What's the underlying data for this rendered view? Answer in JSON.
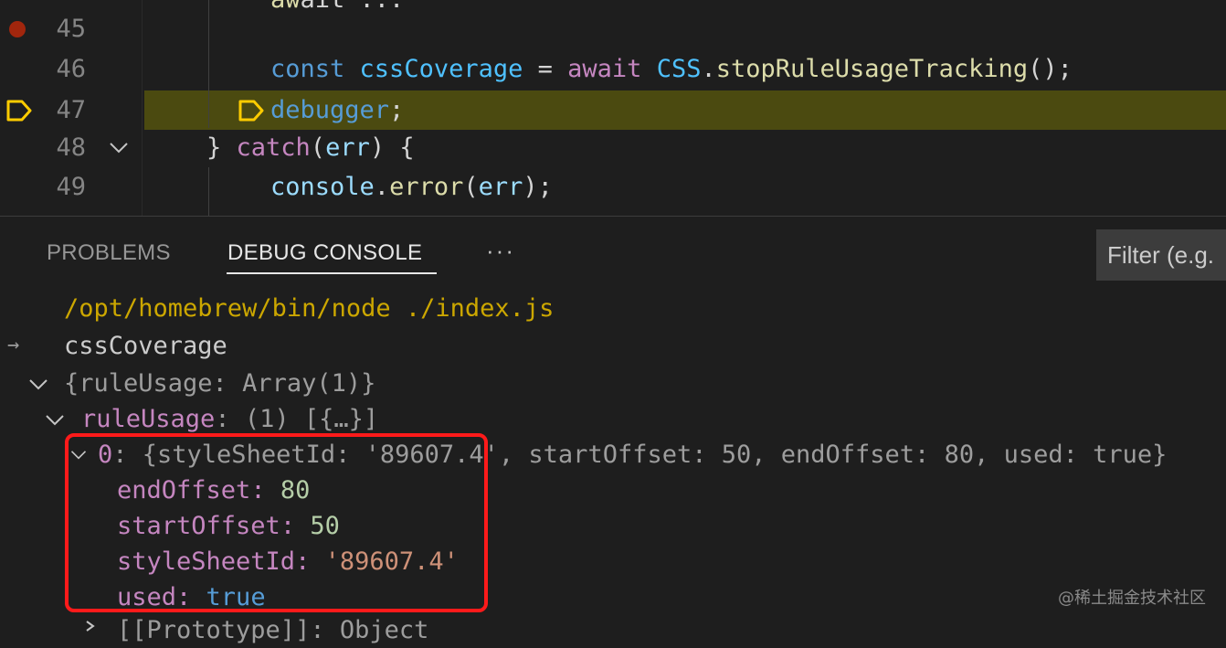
{
  "editor": {
    "lines": [
      {
        "num": "45"
      },
      {
        "num": "46",
        "tokens": [
          {
            "t": "const ",
            "c": "kw2"
          },
          {
            "t": "cssCoverage",
            "c": "var"
          },
          {
            "t": " = ",
            "c": "plain"
          },
          {
            "t": "await ",
            "c": "kw"
          },
          {
            "t": "CSS",
            "c": "var"
          },
          {
            "t": ".",
            "c": "plain"
          },
          {
            "t": "stopRuleUsageTracking",
            "c": "fn"
          },
          {
            "t": "();",
            "c": "plain"
          }
        ]
      },
      {
        "num": "47",
        "tokens": [
          {
            "t": "debugger",
            "c": "kw2"
          },
          {
            "t": ";",
            "c": "plain"
          }
        ]
      },
      {
        "num": "48",
        "tokens": [
          {
            "t": "} ",
            "c": "plain"
          },
          {
            "t": "catch",
            "c": "kw"
          },
          {
            "t": "(",
            "c": "plain"
          },
          {
            "t": "err",
            "c": "prop"
          },
          {
            "t": ") {",
            "c": "plain"
          }
        ]
      },
      {
        "num": "49",
        "tokens": [
          {
            "t": "console",
            "c": "prop"
          },
          {
            "t": ".",
            "c": "plain"
          },
          {
            "t": "error",
            "c": "fn"
          },
          {
            "t": "(",
            "c": "plain"
          },
          {
            "t": "err",
            "c": "prop"
          },
          {
            "t": ");",
            "c": "plain"
          }
        ]
      }
    ]
  },
  "panel": {
    "tabs": [
      "PROBLEMS",
      "DEBUG CONSOLE"
    ],
    "more_label": "···",
    "filter_placeholder": "Filter (e.g."
  },
  "console": {
    "launch_cmd": "/opt/homebrew/bin/node ./index.js",
    "input_arrow": "→",
    "input_expr": "cssCoverage",
    "root_summary": "{ruleUsage: Array(1)}",
    "rule_usage_key": "ruleUsage",
    "rule_usage_sep": ": ",
    "rule_usage_summary": "(1) [{…}]",
    "item0_key": "0",
    "item0_summary": ": {styleSheetId: '89607.4', startOffset: 50, endOffset: 80, used: true}",
    "props": [
      {
        "key": "endOffset",
        "value": "80",
        "type": "num"
      },
      {
        "key": "startOffset",
        "value": "50",
        "type": "num"
      },
      {
        "key": "styleSheetId",
        "value": "'89607.4'",
        "type": "str"
      },
      {
        "key": "used",
        "value": "true",
        "type": "bool"
      }
    ],
    "prototype_line": "[[Prototype]]: Object"
  },
  "watermark": "@稀土掘金技术社区"
}
